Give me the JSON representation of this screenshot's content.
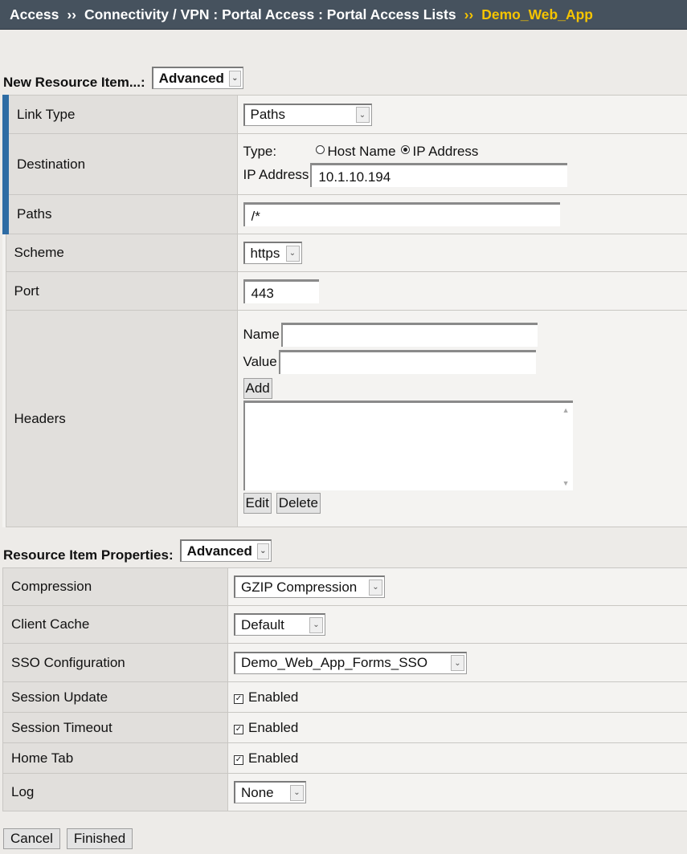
{
  "breadcrumb": {
    "items": [
      "Access",
      "Connectivity / VPN : Portal Access : Portal Access Lists"
    ],
    "separator": "››",
    "current": "Demo_Web_App"
  },
  "new_resource": {
    "label": "New Resource Item...:",
    "mode": "Advanced"
  },
  "resource": {
    "link_type_label": "Link Type",
    "link_type_value": "Paths",
    "destination_label": "Destination",
    "type_label": "Type:",
    "type_option_host": "Host Name",
    "type_option_ip": "IP Address",
    "ip_address_label": "IP Address",
    "ip_address_value": "10.1.10.194",
    "paths_label": "Paths",
    "paths_value": "/*",
    "scheme_label": "Scheme",
    "scheme_value": "https",
    "port_label": "Port",
    "port_value": "443",
    "headers_label": "Headers",
    "header_name_label": "Name",
    "header_value_label": "Value",
    "add_label": "Add",
    "edit_label": "Edit",
    "delete_label": "Delete"
  },
  "properties": {
    "label": "Resource Item Properties:",
    "mode": "Advanced",
    "compression_label": "Compression",
    "compression_value": "GZIP Compression",
    "client_cache_label": "Client Cache",
    "client_cache_value": "Default",
    "sso_label": "SSO Configuration",
    "sso_value": "Demo_Web_App_Forms_SSO",
    "session_update_label": "Session Update",
    "session_timeout_label": "Session Timeout",
    "home_tab_label": "Home Tab",
    "enabled_label": "Enabled",
    "log_label": "Log",
    "log_value": "None"
  },
  "footer": {
    "cancel_label": "Cancel",
    "finished_label": "Finished"
  },
  "colors": {
    "header_bg": "#46525e",
    "current_crumb": "#f5c400",
    "required_marker": "#2e6ca4"
  }
}
